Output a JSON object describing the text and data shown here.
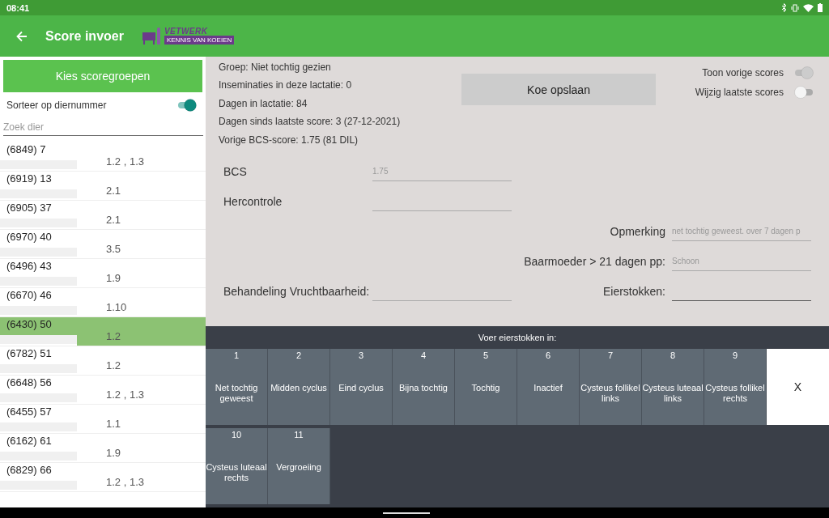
{
  "status_bar": {
    "time": "08:41"
  },
  "toolbar": {
    "title": "Score invoer",
    "logo": {
      "name": "VETWERK",
      "tagline": "KENNIS VAN KOEIEN"
    }
  },
  "sidebar": {
    "button": "Kies scoregroepen",
    "sort_toggle": {
      "label": "Sorteer op diernummer",
      "on": true,
      "disabled": false
    },
    "search": {
      "placeholder": "Zoek dier"
    },
    "animals": [
      {
        "id": "(6849) 7",
        "scores": "1.2 , 1.3",
        "selected": false
      },
      {
        "id": "(6919) 13",
        "scores": "2.1",
        "selected": false
      },
      {
        "id": "(6905) 37",
        "scores": "2.1",
        "selected": false
      },
      {
        "id": "(6970) 40",
        "scores": "3.5",
        "selected": false
      },
      {
        "id": "(6496) 43",
        "scores": "1.9",
        "selected": false
      },
      {
        "id": "(6670) 46",
        "scores": "1.10",
        "selected": false
      },
      {
        "id": "(6430) 50",
        "scores": "1.2",
        "selected": true
      },
      {
        "id": "(6782) 51",
        "scores": "1.2",
        "selected": false
      },
      {
        "id": "(6648) 56",
        "scores": "1.2 , 1.3",
        "selected": false
      },
      {
        "id": "(6455) 57",
        "scores": "1.1",
        "selected": false
      },
      {
        "id": "(6162) 61",
        "scores": "1.9",
        "selected": false
      },
      {
        "id": "(6829) 66",
        "scores": "1.2 , 1.3",
        "selected": false
      }
    ]
  },
  "info": [
    "Groep: Niet tochtig gezien",
    "Inseminaties in deze lactatie: 0",
    "Dagen in lactatie: 84",
    "Dagen sinds laatste score: 3 (27-12-2021)",
    "Vorige BCS-score: 1.75  (81 DIL)"
  ],
  "save_button": "Koe opslaan",
  "toggles": [
    {
      "label": "Toon vorige scores",
      "on": true,
      "disabled": true
    },
    {
      "label": "Wijzig laatste scores",
      "on": false,
      "disabled": false
    }
  ],
  "form_left": [
    {
      "label": "BCS",
      "placeholder": "1.75",
      "focused": false
    },
    {
      "label": "Hercontrole",
      "focused": false
    },
    {
      "label": "Behandeling Vruchtbaarheid:",
      "focused": false
    }
  ],
  "form_right": [
    {
      "label": "Opmerking",
      "placeholder": "net tochtig geweest. over 7 dagen p",
      "focused": false
    },
    {
      "label": "Baarmoeder > 21 dagen pp:",
      "placeholder": "Schoon",
      "focused": false
    },
    {
      "label": "Eierstokken:",
      "focused": true
    }
  ],
  "keypad": {
    "title": "Voer eierstokken in:",
    "keys": [
      {
        "number": "1",
        "label": "Net tochtig geweest"
      },
      {
        "number": "2",
        "label": "Midden cyclus"
      },
      {
        "number": "3",
        "label": "Eind cyclus"
      },
      {
        "number": "4",
        "label": "Bijna tochtig"
      },
      {
        "number": "5",
        "label": "Tochtig"
      },
      {
        "number": "6",
        "label": "Inactief"
      },
      {
        "number": "7",
        "label": "Cysteus follikel links"
      },
      {
        "number": "8",
        "label": "Cysteus luteaal links"
      },
      {
        "number": "9",
        "label": "Cysteus follikel rechts"
      },
      {
        "number": "10",
        "label": "Cysteus luteaal rechts"
      },
      {
        "number": "11",
        "label": "Vergroeiing"
      }
    ],
    "close": "X"
  }
}
